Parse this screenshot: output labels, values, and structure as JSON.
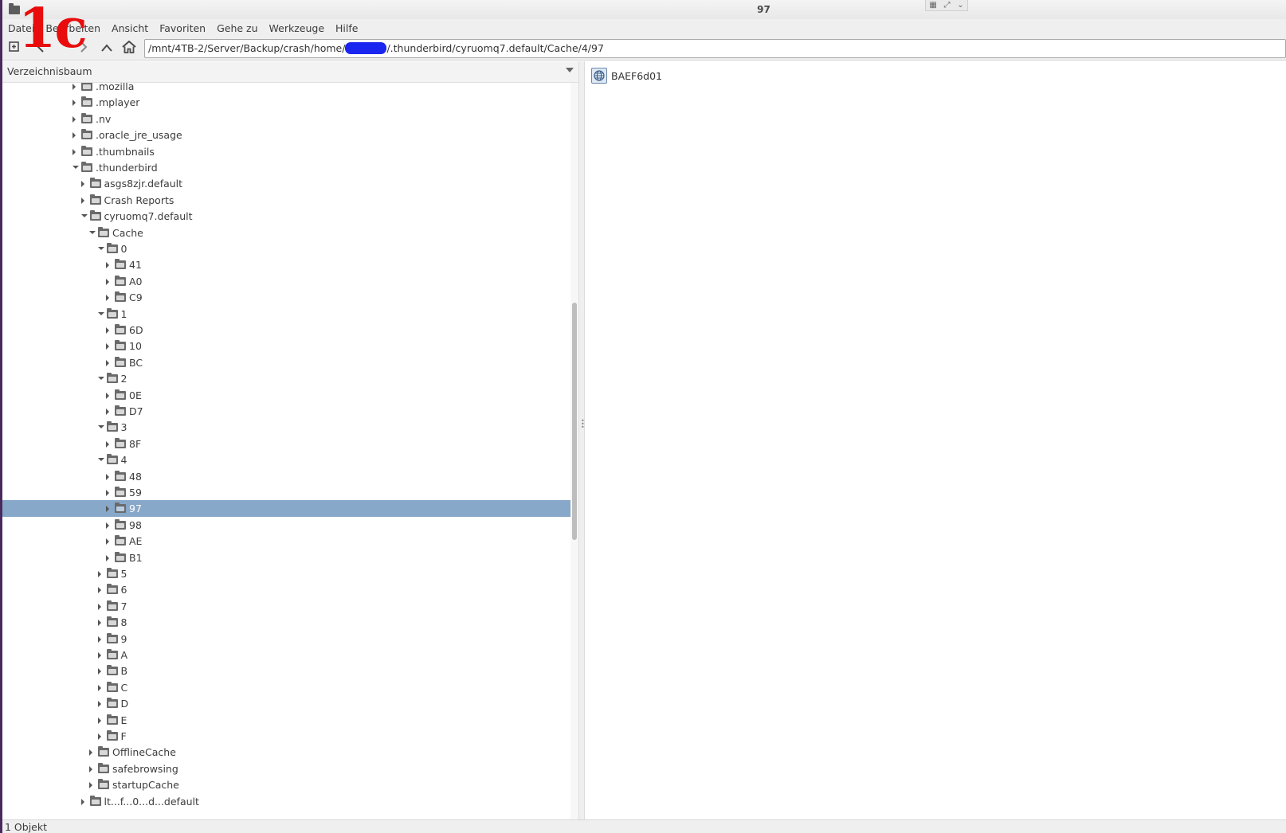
{
  "window": {
    "title": "97"
  },
  "watermark": "1c",
  "menubar": {
    "items": [
      "Datei",
      "Bearbeiten",
      "Ansicht",
      "Favoriten",
      "Gehe zu",
      "Werkzeuge",
      "Hilfe"
    ]
  },
  "toolbar": {
    "icons": [
      "new-tab-icon",
      "back-icon",
      "forward-icon",
      "up-icon",
      "home-icon"
    ],
    "path_prefix": "/mnt/4TB-2/Server/Backup/crash/home/",
    "path_suffix": "/.thunderbird/cyruomq7.default/Cache/4/97"
  },
  "left_panel": {
    "header": "Verzeichnisbaum",
    "tree": [
      {
        "label": ".mozilla",
        "depth": 0,
        "state": "collapsed",
        "selected": false
      },
      {
        "label": ".mplayer",
        "depth": 0,
        "state": "collapsed",
        "selected": false
      },
      {
        "label": ".nv",
        "depth": 0,
        "state": "collapsed",
        "selected": false
      },
      {
        "label": ".oracle_jre_usage",
        "depth": 0,
        "state": "collapsed",
        "selected": false
      },
      {
        "label": ".thumbnails",
        "depth": 0,
        "state": "collapsed",
        "selected": false
      },
      {
        "label": ".thunderbird",
        "depth": 0,
        "state": "expanded",
        "selected": false
      },
      {
        "label": "asgs8zjr.default",
        "depth": 1,
        "state": "collapsed",
        "selected": false
      },
      {
        "label": "Crash Reports",
        "depth": 1,
        "state": "collapsed",
        "selected": false
      },
      {
        "label": "cyruomq7.default",
        "depth": 1,
        "state": "expanded",
        "selected": false
      },
      {
        "label": "Cache",
        "depth": 2,
        "state": "expanded",
        "selected": false
      },
      {
        "label": "0",
        "depth": 3,
        "state": "expanded",
        "selected": false
      },
      {
        "label": "41",
        "depth": 4,
        "state": "collapsed",
        "selected": false
      },
      {
        "label": "A0",
        "depth": 4,
        "state": "collapsed",
        "selected": false
      },
      {
        "label": "C9",
        "depth": 4,
        "state": "collapsed",
        "selected": false
      },
      {
        "label": "1",
        "depth": 3,
        "state": "expanded",
        "selected": false
      },
      {
        "label": "6D",
        "depth": 4,
        "state": "collapsed",
        "selected": false
      },
      {
        "label": "10",
        "depth": 4,
        "state": "collapsed",
        "selected": false
      },
      {
        "label": "BC",
        "depth": 4,
        "state": "collapsed",
        "selected": false
      },
      {
        "label": "2",
        "depth": 3,
        "state": "expanded",
        "selected": false
      },
      {
        "label": "0E",
        "depth": 4,
        "state": "collapsed",
        "selected": false
      },
      {
        "label": "D7",
        "depth": 4,
        "state": "collapsed",
        "selected": false
      },
      {
        "label": "3",
        "depth": 3,
        "state": "expanded",
        "selected": false
      },
      {
        "label": "8F",
        "depth": 4,
        "state": "collapsed",
        "selected": false
      },
      {
        "label": "4",
        "depth": 3,
        "state": "expanded",
        "selected": false
      },
      {
        "label": "48",
        "depth": 4,
        "state": "collapsed",
        "selected": false
      },
      {
        "label": "59",
        "depth": 4,
        "state": "collapsed",
        "selected": false
      },
      {
        "label": "97",
        "depth": 4,
        "state": "collapsed",
        "selected": true
      },
      {
        "label": "98",
        "depth": 4,
        "state": "collapsed",
        "selected": false
      },
      {
        "label": "AE",
        "depth": 4,
        "state": "collapsed",
        "selected": false
      },
      {
        "label": "B1",
        "depth": 4,
        "state": "collapsed",
        "selected": false
      },
      {
        "label": "5",
        "depth": 3,
        "state": "collapsed",
        "selected": false
      },
      {
        "label": "6",
        "depth": 3,
        "state": "collapsed",
        "selected": false
      },
      {
        "label": "7",
        "depth": 3,
        "state": "collapsed",
        "selected": false
      },
      {
        "label": "8",
        "depth": 3,
        "state": "collapsed",
        "selected": false
      },
      {
        "label": "9",
        "depth": 3,
        "state": "collapsed",
        "selected": false
      },
      {
        "label": "A",
        "depth": 3,
        "state": "collapsed",
        "selected": false
      },
      {
        "label": "B",
        "depth": 3,
        "state": "collapsed",
        "selected": false
      },
      {
        "label": "C",
        "depth": 3,
        "state": "collapsed",
        "selected": false
      },
      {
        "label": "D",
        "depth": 3,
        "state": "collapsed",
        "selected": false
      },
      {
        "label": "E",
        "depth": 3,
        "state": "collapsed",
        "selected": false
      },
      {
        "label": "F",
        "depth": 3,
        "state": "collapsed",
        "selected": false
      },
      {
        "label": "OfflineCache",
        "depth": 2,
        "state": "collapsed",
        "selected": false
      },
      {
        "label": "safebrowsing",
        "depth": 2,
        "state": "collapsed",
        "selected": false
      },
      {
        "label": "startupCache",
        "depth": 2,
        "state": "collapsed",
        "selected": false
      },
      {
        "label": "lt...f...0...d...default",
        "depth": 1,
        "state": "collapsed",
        "selected": false
      }
    ]
  },
  "right_panel": {
    "files": [
      {
        "name": "BAEF6d01",
        "icon": "web-file-icon"
      }
    ]
  },
  "statusbar": {
    "text": "1 Objekt"
  },
  "colors": {
    "selection": "#87a8c8",
    "redaction": "#1b25f0",
    "watermark": "#e80c0c"
  }
}
